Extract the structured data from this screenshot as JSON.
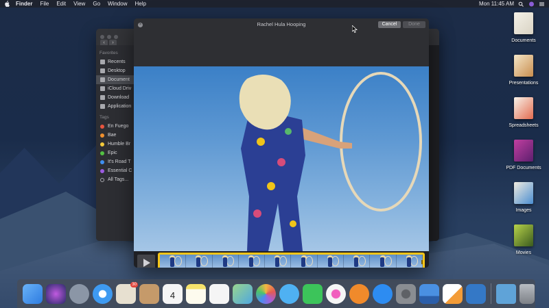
{
  "menubar": {
    "app": "Finder",
    "items": [
      "File",
      "Edit",
      "View",
      "Go",
      "Window",
      "Help"
    ],
    "clock": "Mon 11:45 AM"
  },
  "finder": {
    "sidebar": {
      "favorites_heading": "Favorites",
      "favorites": [
        "Recents",
        "Desktop",
        "Document",
        "iCloud Driv",
        "Download",
        "Application"
      ],
      "tags_heading": "Tags",
      "tags": [
        {
          "label": "En Fuego",
          "color": "#e8553f"
        },
        {
          "label": "Bae",
          "color": "#f0902e"
        },
        {
          "label": "Humble Br",
          "color": "#f2c93a"
        },
        {
          "label": "Epic",
          "color": "#53c143"
        },
        {
          "label": "It's Road T",
          "color": "#3e8ff0"
        },
        {
          "label": "Essential C",
          "color": "#9c5ce0"
        },
        {
          "label": "All Tags...",
          "color": "none"
        }
      ]
    }
  },
  "quicklook": {
    "title": "Rachel Hula Hooping",
    "cancel_label": "Cancel",
    "done_label": "Done"
  },
  "desktop_icons": [
    {
      "label": "Documents",
      "icon": "documents-stack-icon"
    },
    {
      "label": "Presentations",
      "icon": "presentations-stack-icon"
    },
    {
      "label": "Spreadsheets",
      "icon": "spreadsheets-stack-icon"
    },
    {
      "label": "PDF Documents",
      "icon": "pdf-stack-icon"
    },
    {
      "label": "Images",
      "icon": "images-stack-icon"
    },
    {
      "label": "Movies",
      "icon": "movies-stack-icon"
    }
  ],
  "dock": {
    "photo_badge": "30",
    "calendar_day": "4",
    "apps": [
      {
        "name": "finder-app-icon",
        "color": "#3d8ff2"
      },
      {
        "name": "siri-app-icon",
        "color": "#2a2a6a"
      },
      {
        "name": "launchpad-app-icon",
        "color": "#8b96a6"
      },
      {
        "name": "safari-app-icon",
        "color": "#3e9af1"
      },
      {
        "name": "photo-app-icon",
        "color": "#e7e0d0"
      },
      {
        "name": "contacts-app-icon",
        "color": "#c59a6a"
      },
      {
        "name": "calendar-app-icon",
        "color": "#f5f5f5"
      },
      {
        "name": "notes-app-icon",
        "color": "#f7e36b"
      },
      {
        "name": "reminders-app-icon",
        "color": "#f5f5f5"
      },
      {
        "name": "maps-app-icon",
        "color": "#6fbf6a"
      },
      {
        "name": "photos-app-icon",
        "color": "#f8f8f8"
      },
      {
        "name": "messages-app-icon",
        "color": "#4fb1f2"
      },
      {
        "name": "facetime-app-icon",
        "color": "#3cc45a"
      },
      {
        "name": "itunes-app-icon",
        "color": "#f5f5f5"
      },
      {
        "name": "books-app-icon",
        "color": "#f08a2b"
      },
      {
        "name": "appstore-app-icon",
        "color": "#2d8cf1"
      },
      {
        "name": "system-preferences-app-icon",
        "color": "#8a8d92"
      },
      {
        "name": "keynote-app-icon",
        "color": "#4a90e2"
      },
      {
        "name": "pages-app-icon",
        "color": "#f39c38"
      },
      {
        "name": "xcode-app-icon",
        "color": "#3478c6"
      }
    ],
    "extras": [
      {
        "name": "downloads-stack-icon",
        "color": "#5fa3d8"
      },
      {
        "name": "trash-icon",
        "color": "#9ca0a6"
      }
    ]
  }
}
